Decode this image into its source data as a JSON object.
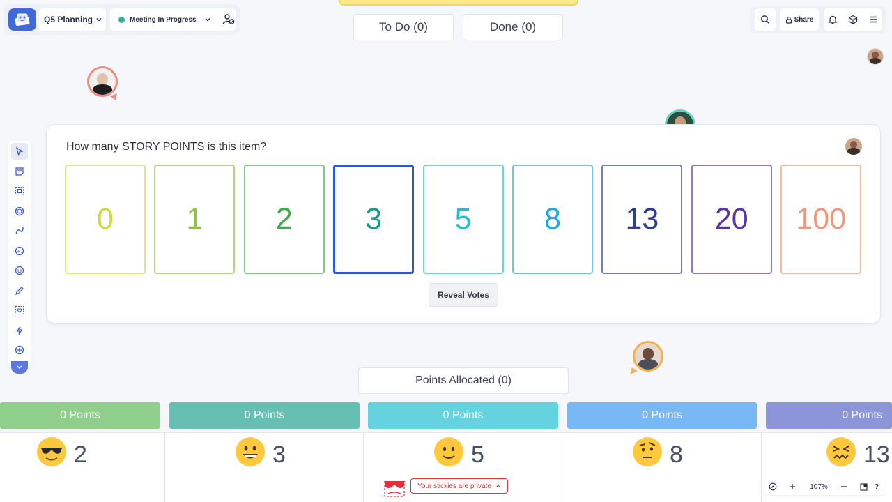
{
  "header": {
    "board_name": "Q5 Planning",
    "meeting_status": "Meeting In Progress",
    "share_label": "Share"
  },
  "tabs": [
    {
      "label": "To Do (0)"
    },
    {
      "label": "Done (0)"
    }
  ],
  "voting": {
    "question": "How many STORY POINTS is this item?",
    "cards": [
      {
        "value": "0",
        "color": "#c6dc3f"
      },
      {
        "value": "1",
        "color": "#8cc63e"
      },
      {
        "value": "2",
        "color": "#3aae4a"
      },
      {
        "value": "3",
        "color": "#179a8c"
      },
      {
        "value": "5",
        "color": "#1cbfcf"
      },
      {
        "value": "8",
        "color": "#1ea8e0"
      },
      {
        "value": "13",
        "color": "#2f3f8f"
      },
      {
        "value": "20",
        "color": "#5b33a8"
      },
      {
        "value": "100",
        "color": "#f0977a"
      }
    ],
    "selected_value": "3",
    "reveal_label": "Reveal Votes"
  },
  "points_allocated": "Points Allocated (0)",
  "columns": [
    {
      "points_label": "0 Points",
      "value": "2",
      "emoji": "sunglasses-emoji",
      "color": "#8fce8b"
    },
    {
      "points_label": "0 Points",
      "value": "3",
      "emoji": "grinning-emoji",
      "color": "#65bfb3"
    },
    {
      "points_label": "0 Points",
      "value": "5",
      "emoji": "slight-smile-emoji",
      "color": "#65d2e0"
    },
    {
      "points_label": "0 Points",
      "value": "8",
      "emoji": "raised-eyebrow-emoji",
      "color": "#78b8f5"
    },
    {
      "points_label": "0 Points",
      "value": "13",
      "emoji": "confounded-emoji",
      "color": "#8b95d8"
    }
  ],
  "private_note": "Your stickies are private",
  "zoom": {
    "level": "107%"
  }
}
